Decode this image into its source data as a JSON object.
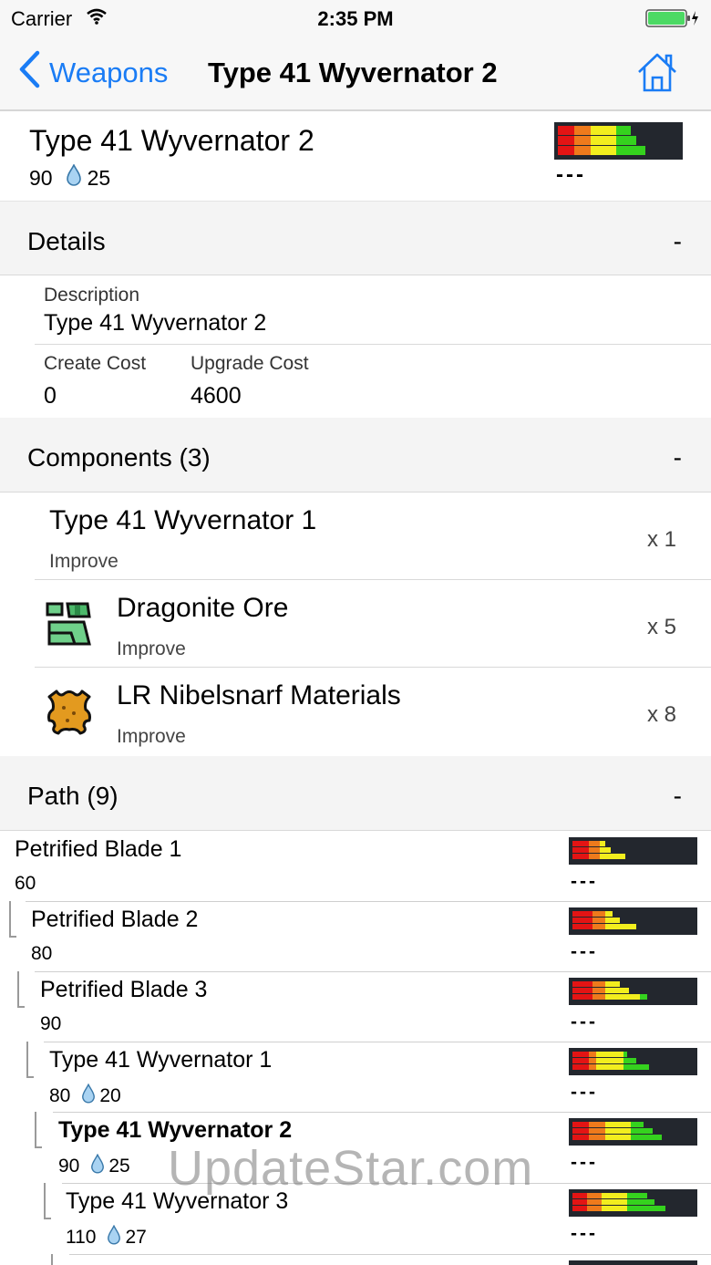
{
  "status_bar": {
    "carrier": "Carrier",
    "time": "2:35 PM"
  },
  "nav": {
    "back_label": "Weapons",
    "title": "Type 41 Wyvernator 2"
  },
  "item": {
    "name": "Type 41 Wyvernator 2",
    "attack": "90",
    "element_value": "25",
    "sharpness_extra": "---"
  },
  "details": {
    "header": "Details",
    "toggle": "-",
    "description_label": "Description",
    "description": "Type 41 Wyvernator 2",
    "create_cost_label": "Create Cost",
    "create_cost": "0",
    "upgrade_cost_label": "Upgrade Cost",
    "upgrade_cost": "4600"
  },
  "components": {
    "header": "Components (3)",
    "toggle": "-",
    "items": [
      {
        "name": "Type 41 Wyvernator 1",
        "type": "Improve",
        "qty": "x 1",
        "icon": "none"
      },
      {
        "name": "Dragonite Ore",
        "type": "Improve",
        "qty": "x 5",
        "icon": "ore-icon"
      },
      {
        "name": "LR Nibelsnarf Materials",
        "type": "Improve",
        "qty": "x 8",
        "icon": "hide-icon"
      }
    ]
  },
  "path": {
    "header": "Path (9)",
    "toggle": "-",
    "items": [
      {
        "name": "Petrified Blade 1",
        "attack": "60",
        "element": "",
        "current": false,
        "dashes": "---"
      },
      {
        "name": "Petrified Blade 2",
        "attack": "80",
        "element": "",
        "current": false,
        "dashes": "---"
      },
      {
        "name": "Petrified Blade 3",
        "attack": "90",
        "element": "",
        "current": false,
        "dashes": "---"
      },
      {
        "name": "Type 41 Wyvernator 1",
        "attack": "80",
        "element": "20",
        "current": false,
        "dashes": "---"
      },
      {
        "name": "Type 41 Wyvernator 2",
        "attack": "90",
        "element": "25",
        "current": true,
        "dashes": "---"
      },
      {
        "name": "Type 41 Wyvernator 3",
        "attack": "110",
        "element": "27",
        "current": false,
        "dashes": "---"
      }
    ]
  },
  "sharpness_colors": {
    "red": "#e31414",
    "orange": "#ee7a1c",
    "yellow": "#f2ee1e",
    "green": "#35d21e",
    "background": "#23272e"
  },
  "accent_color": "#1a7cf5",
  "water_color": "#5aa8e0",
  "watermark": "UpdateStar.com"
}
